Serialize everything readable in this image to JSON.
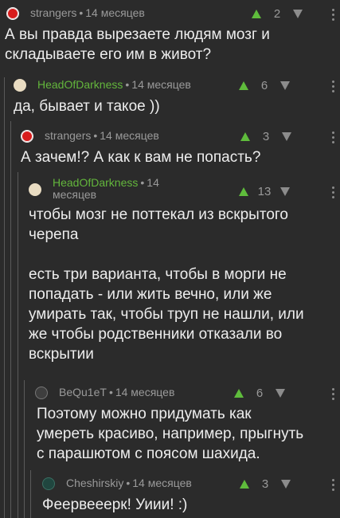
{
  "comments": [
    {
      "author": "strangers",
      "time": "14 месяцев",
      "score": "2",
      "text": "А вы правда вырезаете людям мозг и\nскладываете его им в живот?"
    },
    {
      "author": "HeadOfDarkness",
      "time": "14 месяцев",
      "score": "6",
      "text": "да, бывает и такое ))"
    },
    {
      "author": "strangers",
      "time": "14 месяцев",
      "score": "3",
      "text": "А зачем!? А как к вам не попасть?"
    },
    {
      "author": "HeadOfDarkness",
      "time_line1": "14",
      "time_line2": "месяцев",
      "score": "13",
      "text": "чтобы мозг не поттекал из вскрытого\nчерепа\n\nесть три варианта, чтобы в морги не\nпопадать - или жить вечно, или же\nумирать так, чтобы труп не нашли, или\nже чтобы родственники отказали во\nвскрытии"
    },
    {
      "author": "BeQu1eT",
      "time": "14 месяцев",
      "score": "6",
      "text": "Поэтому можно придумать как\nумереть красиво, например, прыгнуть\nс парашютом с поясом шахида."
    },
    {
      "author": "Cheshirskiy",
      "time": "14 месяцев",
      "score": "3",
      "text": "Феервееерк! Уиии! :)"
    }
  ],
  "separator": "•",
  "colors": {
    "background": "#2b2b2b",
    "author_highlight": "#63b63c",
    "upvote": "#5fbc3c",
    "thread_line": "#5a5a5a"
  },
  "icons": {
    "upvote": "triangle-up",
    "downvote": "triangle-down",
    "more": "vertical-ellipsis"
  }
}
